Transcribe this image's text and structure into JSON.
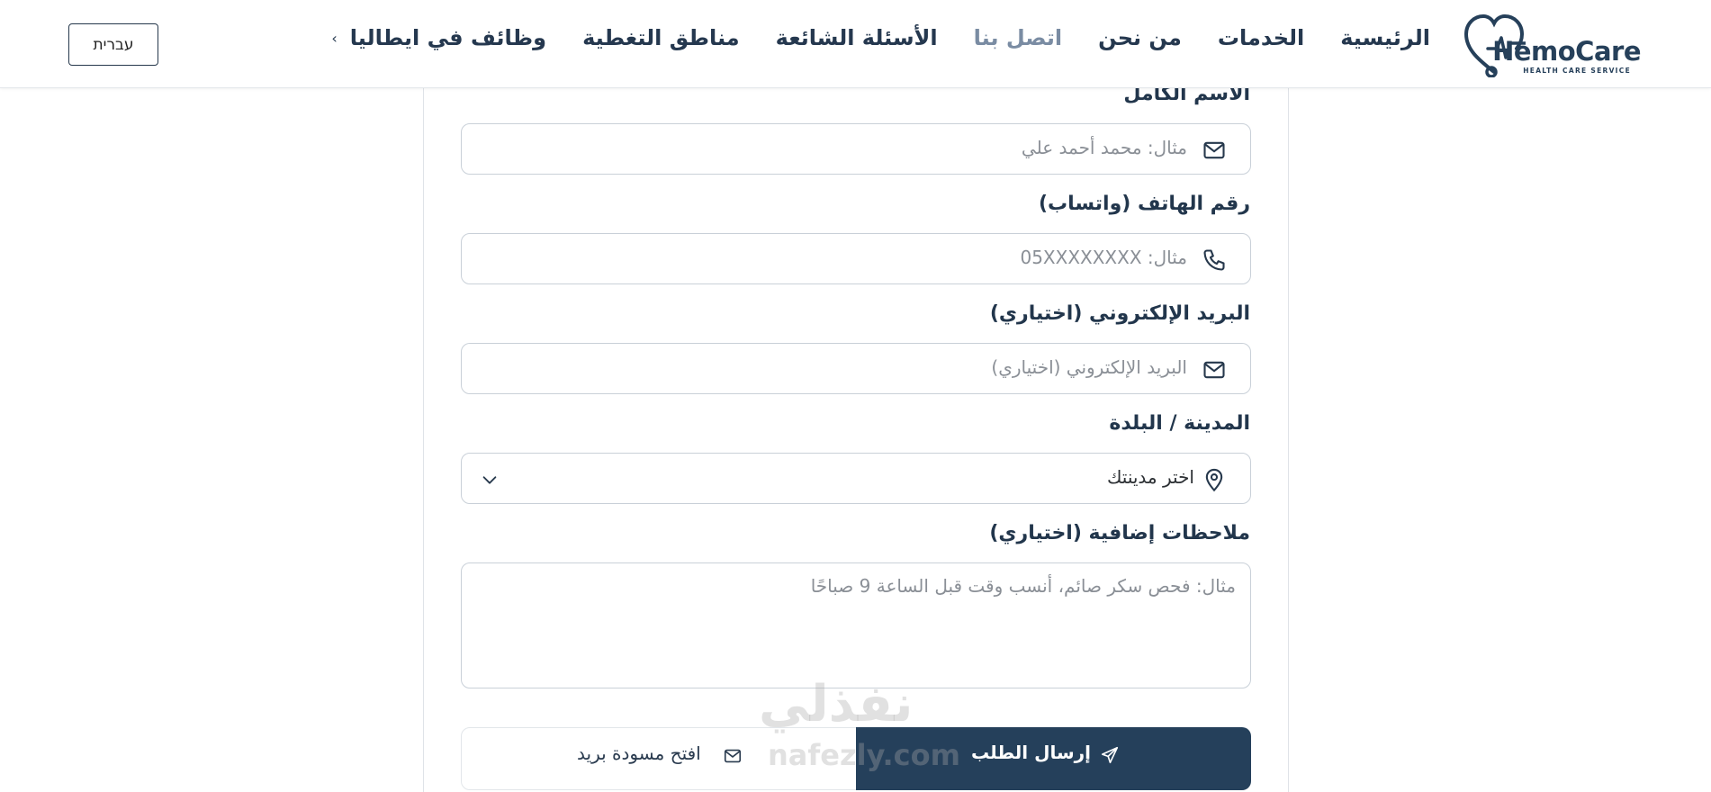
{
  "brand": {
    "name": "HemoCare",
    "tagline": "HEALTH CARE SERVICE",
    "color": "#26405a"
  },
  "nav": {
    "items": [
      {
        "label": "الرئيسية"
      },
      {
        "label": "الخدمات"
      },
      {
        "label": "من نحن"
      },
      {
        "label": "اتصل بنا",
        "active": true
      },
      {
        "label": "الأسئلة الشائعة"
      },
      {
        "label": "مناطق التغطية"
      },
      {
        "label": "وظائف في ايطاليا"
      }
    ],
    "active_color": "#7a8ca3"
  },
  "language_button": "עברית",
  "form": {
    "full_name": {
      "label": "الاسم الكامل",
      "placeholder": "مثال: محمد أحمد علي",
      "icon": "mail-icon"
    },
    "phone": {
      "label": "رقم الهاتف (واتساب)",
      "placeholder": "مثال: 05XXXXXXXX",
      "icon": "phone-icon"
    },
    "email": {
      "label": "البريد الإلكتروني (اختياري)",
      "placeholder": "البريد الإلكتروني (اختياري)",
      "icon": "mail-icon"
    },
    "city": {
      "label": "المدينة / البلدة",
      "selected": "اختر مدينتك",
      "icon": "map-pin-icon"
    },
    "notes": {
      "label": "ملاحظات إضافية (اختياري)",
      "placeholder": "مثال: فحص سكر صائم، أنسب وقت قبل الساعة 9 صباحًا"
    },
    "submit_label": "إرسال الطلب",
    "draft_label": "افتح مسودة بريد",
    "submit_color": "#25405b"
  },
  "watermark": {
    "arabic": "نفذلي",
    "latin": "nafezly.com"
  }
}
